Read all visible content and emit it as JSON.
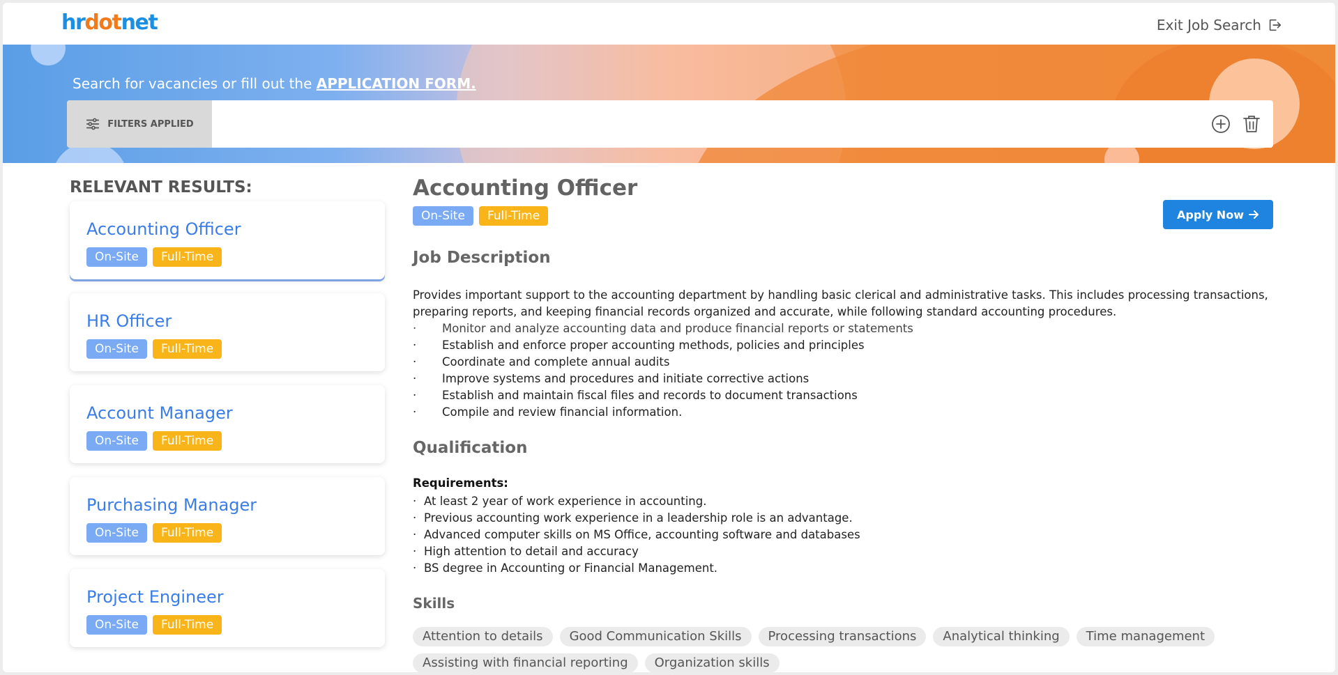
{
  "header": {
    "logo": {
      "part1": "hr",
      "part2": "dot",
      "part3": "net"
    },
    "exit_label": "Exit Job Search",
    "exit_icon": "logout-icon"
  },
  "banner": {
    "text_prefix": "Search for vacancies or fill out the ",
    "application_link": "APPLICATION FORM.",
    "filters_label": "FILTERS APPLIED",
    "filters_icon": "sliders-icon",
    "add_icon": "plus-circle-icon",
    "delete_icon": "trash-icon"
  },
  "results": {
    "heading": "RELEVANT RESULTS:",
    "items": [
      {
        "title": "Accounting Officer",
        "tag1": "On-Site",
        "tag2": "Full-Time"
      },
      {
        "title": "HR Officer",
        "tag1": "On-Site",
        "tag2": "Full-Time"
      },
      {
        "title": "Account Manager",
        "tag1": "On-Site",
        "tag2": "Full-Time"
      },
      {
        "title": "Purchasing Manager",
        "tag1": "On-Site",
        "tag2": "Full-Time"
      },
      {
        "title": "Project Engineer",
        "tag1": "On-Site",
        "tag2": "Full-Time"
      }
    ]
  },
  "detail": {
    "title": "Accounting Officer",
    "tag1": "On-Site",
    "tag2": "Full-Time",
    "apply_label": "Apply Now",
    "job_description_heading": "Job Description",
    "description": "Provides important support to the accounting department by handling basic clerical and administrative tasks. This includes processing transactions, preparing reports, and keeping financial records organized and accurate, while following standard accounting procedures.",
    "duties": [
      "Monitor and analyze accounting data and produce financial reports or statements",
      "Establish and enforce proper accounting methods, policies and principles",
      "Coordinate and complete annual audits",
      "Improve systems and procedures and initiate corrective actions",
      "Establish and maintain fiscal files and records to document transactions",
      "Compile and review financial information."
    ],
    "qualification_heading": "Qualification",
    "requirements_label": "Requirements:",
    "requirements": [
      "At least 2 year of work experience in accounting.",
      "Previous accounting work experience in a leadership role is an advantage.",
      "Advanced computer skills on MS Office, accounting software and databases",
      "High attention to detail and accuracy",
      "BS degree in Accounting or Financial Management."
    ],
    "skills_heading": "Skills",
    "skills": [
      "Attention to details",
      "Good Communication Skills",
      "Processing transactions",
      "Analytical thinking",
      "Time management",
      "Assisting with financial reporting",
      "Organization skills"
    ]
  },
  "colors": {
    "primary_blue": "#1f84e0",
    "link_blue": "#3a7de8",
    "onsite_tag": "#7aaaf4",
    "fulltime_tag": "#f8b418",
    "banner_orange": "#ee8a35"
  }
}
